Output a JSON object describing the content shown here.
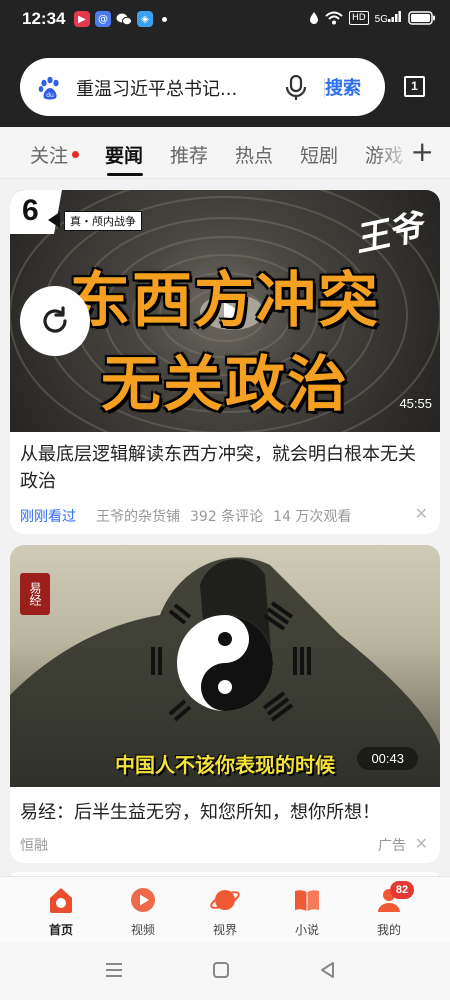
{
  "status_bar": {
    "time": "12:34",
    "hd": "HD",
    "signal": "5G"
  },
  "search": {
    "query": "重温习近平总书记...",
    "button_label": "搜索",
    "tab_count": "1"
  },
  "channels": {
    "items": [
      "关注",
      "要闻",
      "推荐",
      "热点",
      "短剧",
      "游戏"
    ],
    "active": "要闻",
    "add_icon": "+"
  },
  "feed": [
    {
      "badge_number": "6",
      "badge_label": "真・颅内战争",
      "watermark": "王爷",
      "overlay_line1": "东西方冲突",
      "overlay_line2": "无关政治",
      "duration": "45:55",
      "title": "从最底层逻辑解读东西方冲突，就会明白根本无关政治",
      "seen_label": "刚刚看过",
      "author": "王爷的杂货铺",
      "comments": "392 条评论",
      "views": "14 万次观看"
    },
    {
      "seal_text": "易经",
      "caption": "中国人不该你表现的时候",
      "duration": "00:43",
      "title": "易经：后半生益无穷，知您所知，想你所想！",
      "author": "恒融",
      "ad_label": "广告"
    }
  ],
  "bottom_nav": {
    "items": [
      {
        "label": "首页",
        "icon": "home-icon"
      },
      {
        "label": "视频",
        "icon": "video-icon"
      },
      {
        "label": "视界",
        "icon": "planet-icon"
      },
      {
        "label": "小说",
        "icon": "book-icon"
      },
      {
        "label": "我的",
        "icon": "profile-icon"
      }
    ],
    "active": "首页",
    "profile_badge": "82"
  },
  "colors": {
    "accent_blue": "#2f6ef0",
    "brand_red": "#e94d2b",
    "overlay_orange": "#f5a020"
  }
}
